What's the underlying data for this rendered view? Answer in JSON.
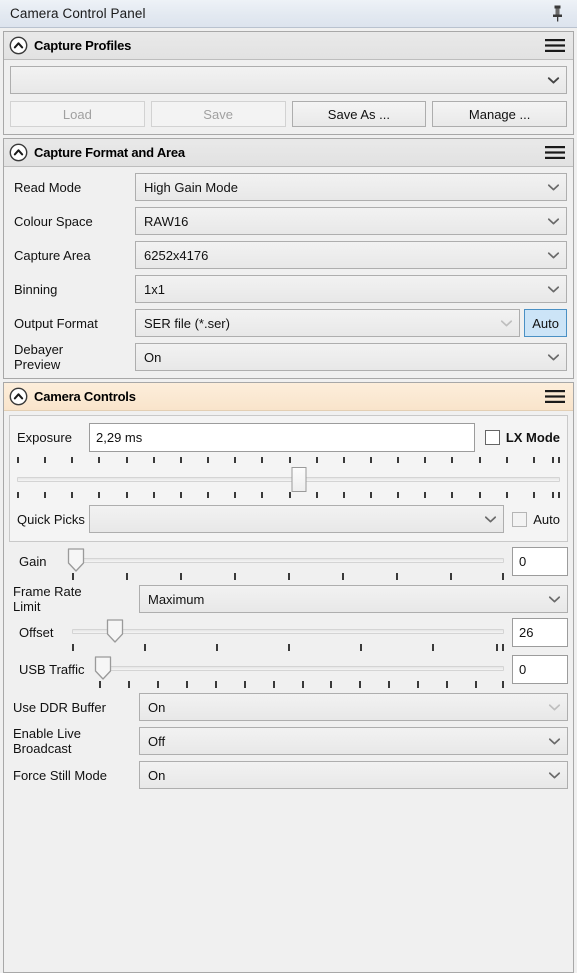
{
  "window": {
    "title": "Camera Control Panel",
    "pin_icon": "pin-icon"
  },
  "sections": {
    "capture_profiles": {
      "title": "Capture Profiles",
      "collapse_icon": "chevron-up-circle-icon",
      "menu_icon": "hamburger-menu-icon",
      "profile_combo": {
        "value": "",
        "placeholder": ""
      },
      "buttons": [
        {
          "label": "Load",
          "enabled": false
        },
        {
          "label": "Save",
          "enabled": false
        },
        {
          "label": "Save As ...",
          "enabled": true
        },
        {
          "label": "Manage ...",
          "enabled": true
        }
      ]
    },
    "capture_format": {
      "title": "Capture Format and Area",
      "collapse_icon": "chevron-up-circle-icon",
      "menu_icon": "hamburger-menu-icon",
      "rows": [
        {
          "label": "Read Mode",
          "value": "High Gain Mode",
          "enabled": true
        },
        {
          "label": "Colour Space",
          "value": "RAW16",
          "enabled": true
        },
        {
          "label": "Capture Area",
          "value": "6252x4176",
          "enabled": true
        },
        {
          "label": "Binning",
          "value": "1x1",
          "enabled": true
        },
        {
          "label": "Output Format",
          "value": "SER file (*.ser)",
          "enabled": false
        },
        {
          "label": "Debayer\nPreview",
          "value": "On",
          "enabled": true
        }
      ],
      "auto_button": {
        "label": "Auto",
        "active": true
      }
    },
    "camera_controls": {
      "title": "Camera Controls",
      "collapse_icon": "chevron-up-circle-icon",
      "menu_icon": "hamburger-menu-icon",
      "exposure": {
        "label": "Exposure",
        "value": "2,29 ms",
        "slider_percent": 52,
        "lx_mode": {
          "label": "LX Mode",
          "checked": false
        }
      },
      "quick_picks": {
        "label": "Quick Picks",
        "value": "",
        "auto": {
          "label": "Auto",
          "checked": false
        }
      },
      "gain": {
        "label": "Gain",
        "value": "0",
        "slider_percent": 1
      },
      "frame_rate_limit": {
        "label": "Frame Rate\nLimit",
        "value": "Maximum",
        "enabled": true
      },
      "offset": {
        "label": "Offset",
        "value": "26",
        "slider_percent": 10
      },
      "usb_traffic": {
        "label": "USB Traffic",
        "value": "0",
        "slider_percent": 1
      },
      "ddr_buffer": {
        "label": "Use DDR Buffer",
        "value": "On",
        "enabled": false
      },
      "live_broadcast": {
        "label": "Enable Live\nBroadcast",
        "value": "Off",
        "enabled": true
      },
      "force_still_mode": {
        "label": "Force Still Mode",
        "value": "On",
        "enabled": true
      }
    }
  },
  "colors": {
    "accent_header": "#f9e4cb",
    "auto_active": "#cce4f7",
    "titlebar": "#e3e9f1",
    "panel_bg": "#f0f0f0"
  }
}
